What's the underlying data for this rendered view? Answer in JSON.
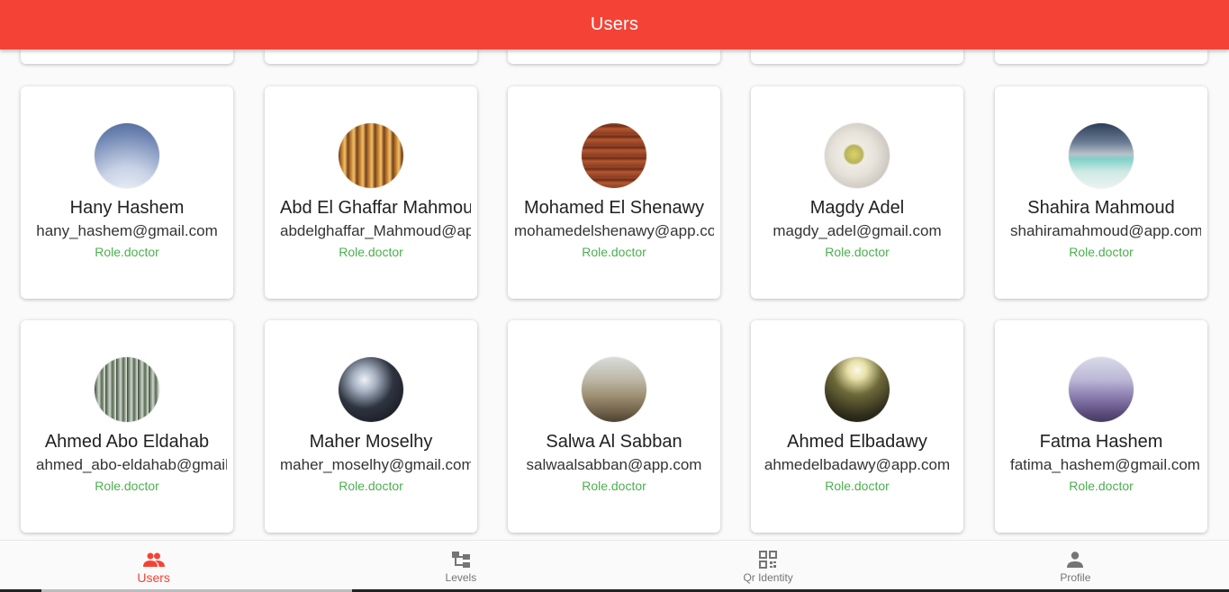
{
  "appbar": {
    "title": "Users",
    "color": "#f44336"
  },
  "users": [
    {
      "name": "Hany Hashem",
      "email": "hany_hashem@gmail.com",
      "role": "Role.doctor",
      "avatar": "sky-photo"
    },
    {
      "name": "Abd El Ghaffar Mahmoud",
      "email": "abdelghaffar_Mahmoud@app.com",
      "role": "Role.doctor",
      "avatar": "cathedral-photo"
    },
    {
      "name": "Mohamed El Shenawy",
      "email": "mohamedelshenawy@app.com",
      "role": "Role.doctor",
      "avatar": "wood-photo"
    },
    {
      "name": "Magdy Adel",
      "email": "magdy_adel@gmail.com",
      "role": "Role.doctor",
      "avatar": "tea-cup-photo"
    },
    {
      "name": "Shahira Mahmoud",
      "email": "shahiramahmoud@app.com",
      "role": "Role.doctor",
      "avatar": "sea-photo"
    },
    {
      "name": "Ahmed Abo Eldahab",
      "email": "ahmed_abo-eldahab@gmail.com",
      "role": "Role.doctor",
      "avatar": "forest-photo"
    },
    {
      "name": "Maher Moselhy",
      "email": "maher_moselhy@gmail.com",
      "role": "Role.doctor",
      "avatar": "phone-photo"
    },
    {
      "name": "Salwa Al Sabban",
      "email": "salwaalsabban@app.com",
      "role": "Role.doctor",
      "avatar": "city-photo"
    },
    {
      "name": "Ahmed Elbadawy",
      "email": "ahmedelbadawy@app.com",
      "role": "Role.doctor",
      "avatar": "building-photo"
    },
    {
      "name": "Fatma Hashem",
      "email": "fatima_hashem@gmail.com",
      "role": "Role.doctor",
      "avatar": "coast-photo"
    }
  ],
  "nav": {
    "items": [
      {
        "label": "Users",
        "icon": "group-icon",
        "active": true
      },
      {
        "label": "Levels",
        "icon": "hierarchy-icon",
        "active": false
      },
      {
        "label": "Qr Identity",
        "icon": "qr-code-icon",
        "active": false
      },
      {
        "label": "Profile",
        "icon": "person-icon",
        "active": false
      }
    ]
  },
  "colors": {
    "accent": "#f44336",
    "role": "#4caf50"
  }
}
